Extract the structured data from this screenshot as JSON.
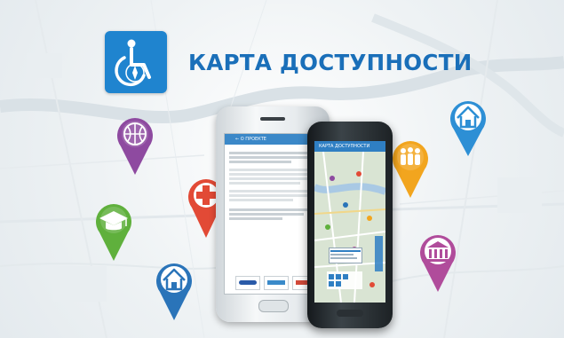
{
  "app": {
    "title": "КАРТА ДОСТУПНОСТИ"
  },
  "colors": {
    "brand_blue": "#1f84cf",
    "title_blue": "#1a6fb9",
    "pin_purple": "#8e4aa0",
    "pin_red": "#e24a36",
    "pin_green": "#5fb03c",
    "pin_blue": "#2a74b9",
    "pin_orange": "#f2a51e",
    "pin_magenta": "#b04c9b",
    "pin_lightblue": "#2d8fd5"
  },
  "icons": {
    "app_icon": "wheelchair-compass-icon",
    "pins": [
      {
        "name": "basketball-pin-icon",
        "color": "#8e4aa0"
      },
      {
        "name": "medical-cross-pin-icon",
        "color": "#e24a36"
      },
      {
        "name": "graduation-cap-pin-icon",
        "color": "#5fb03c"
      },
      {
        "name": "house-pin-icon",
        "color": "#2a74b9"
      },
      {
        "name": "people-pin-icon",
        "color": "#f2a51e"
      },
      {
        "name": "museum-pin-icon",
        "color": "#b04c9b"
      },
      {
        "name": "house-pin-icon",
        "color": "#2d8fd5"
      }
    ]
  },
  "white_phone": {
    "header": "← О ПРОЕКТЕ"
  },
  "dark_phone": {
    "header": "КАРТА ДОСТУПНОСТИ"
  }
}
